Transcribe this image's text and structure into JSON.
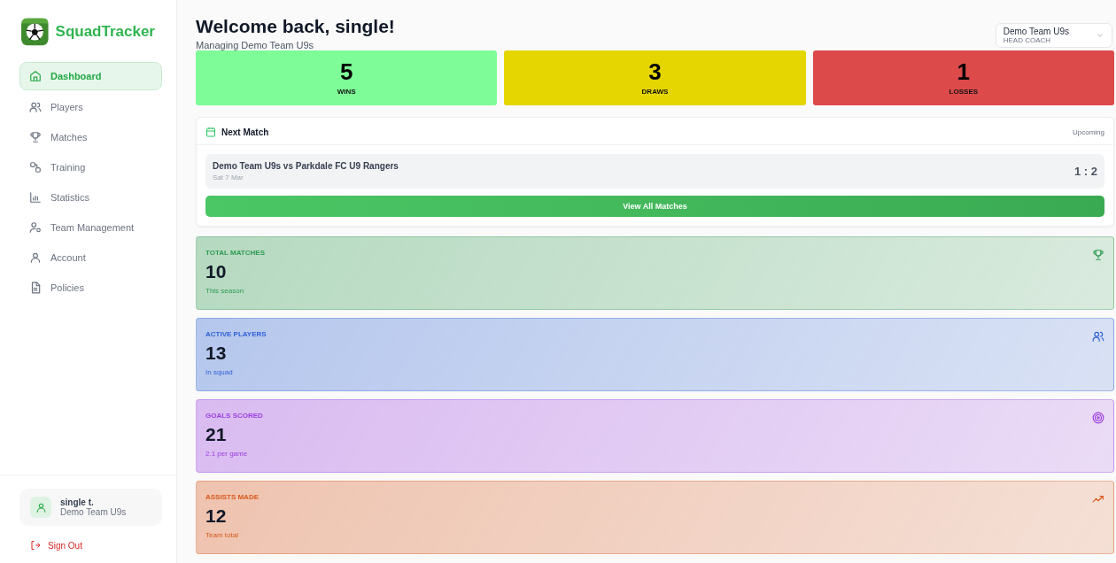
{
  "brand": {
    "name": "SquadTracker"
  },
  "nav": [
    {
      "label": "Dashboard",
      "kind": "home",
      "selected": true
    },
    {
      "label": "Players",
      "kind": "users",
      "selected": false
    },
    {
      "label": "Matches",
      "kind": "trophy",
      "selected": false
    },
    {
      "label": "Training",
      "kind": "training",
      "selected": false
    },
    {
      "label": "Statistics",
      "kind": "chart",
      "selected": false
    },
    {
      "label": "Team Management",
      "kind": "manage",
      "selected": false
    },
    {
      "label": "Account",
      "kind": "user",
      "selected": false
    },
    {
      "label": "Policies",
      "kind": "doc",
      "selected": false
    }
  ],
  "user": {
    "name": "single t.",
    "team": "Demo Team U9s"
  },
  "sign_out": "Sign Out",
  "header": {
    "title": "Welcome back, single!",
    "subtitle": "Managing Demo Team U9s"
  },
  "team_select": {
    "team": "Demo Team U9s",
    "role": "HEAD COACH"
  },
  "results": [
    {
      "value": "5",
      "label": "WINS",
      "color": "#7dfc98"
    },
    {
      "value": "3",
      "label": "DRAWS",
      "color": "#e5d500"
    },
    {
      "value": "1",
      "label": "LOSSES",
      "color": "#dc4a4a"
    }
  ],
  "next_match": {
    "title": "Next Match",
    "status": "Upcoming",
    "fixture": "Demo Team U9s vs Parkdale FC U9 Rangers",
    "date": "Sat 7 Mar",
    "score": "1 : 2",
    "button": "View All Matches"
  },
  "stats": [
    {
      "label": "TOTAL MATCHES",
      "value": "10",
      "note": "This season",
      "kind": "trophy",
      "color": "#2f9a4f"
    },
    {
      "label": "ACTIVE PLAYERS",
      "value": "13",
      "note": "In squad",
      "kind": "users",
      "color": "#2f63d6"
    },
    {
      "label": "GOALS SCORED",
      "value": "21",
      "note": "2.1 per game",
      "kind": "target",
      "color": "#9a3fe0"
    },
    {
      "label": "ASSISTS MADE",
      "value": "12",
      "note": "Team total",
      "kind": "trend",
      "color": "#d9581c"
    }
  ]
}
